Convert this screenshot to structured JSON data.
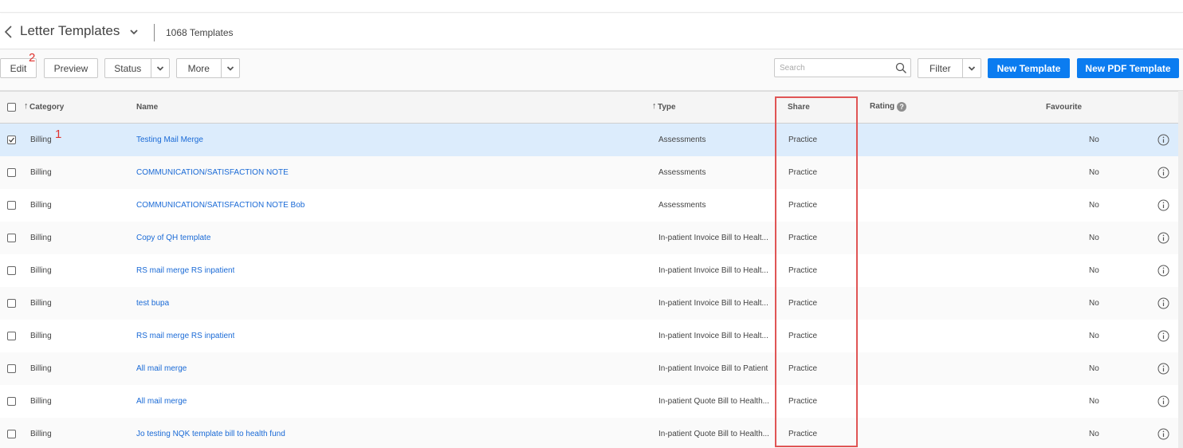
{
  "header": {
    "title": "Letter Templates",
    "count": "1068 Templates"
  },
  "toolbar": {
    "edit_label": "Edit",
    "preview_label": "Preview",
    "status_label": "Status",
    "more_label": "More",
    "search_placeholder": "Search",
    "filter_label": "Filter",
    "new_template_label": "New Template",
    "new_pdf_template_label": "New PDF Template"
  },
  "annotations": {
    "marker_1": "1",
    "marker_2": "2"
  },
  "columns": {
    "category": "Category",
    "name": "Name",
    "type": "Type",
    "share": "Share",
    "rating": "Rating",
    "rating_help": "?",
    "favourite": "Favourite"
  },
  "rows": [
    {
      "category": "Billing",
      "name": "Testing Mail Merge",
      "type": "Assessments",
      "share": "Practice",
      "favourite": "No",
      "checked": true
    },
    {
      "category": "Billing",
      "name": "COMMUNICATION/SATISFACTION NOTE",
      "type": "Assessments",
      "share": "Practice",
      "favourite": "No",
      "checked": false
    },
    {
      "category": "Billing",
      "name": "COMMUNICATION/SATISFACTION NOTE Bob",
      "type": "Assessments",
      "share": "Practice",
      "favourite": "No",
      "checked": false
    },
    {
      "category": "Billing",
      "name": "Copy of QH template",
      "type": "In-patient Invoice Bill to Healt...",
      "share": "Practice",
      "favourite": "No",
      "checked": false
    },
    {
      "category": "Billing",
      "name": "RS mail merge RS inpatient",
      "type": "In-patient Invoice Bill to Healt...",
      "share": "Practice",
      "favourite": "No",
      "checked": false
    },
    {
      "category": "Billing",
      "name": "test bupa",
      "type": "In-patient Invoice Bill to Healt...",
      "share": "Practice",
      "favourite": "No",
      "checked": false
    },
    {
      "category": "Billing",
      "name": "RS mail merge RS inpatient",
      "type": "In-patient Invoice Bill to Healt...",
      "share": "Practice",
      "favourite": "No",
      "checked": false
    },
    {
      "category": "Billing",
      "name": "All mail merge",
      "type": "In-patient Invoice Bill to Patient",
      "share": "Practice",
      "favourite": "No",
      "checked": false
    },
    {
      "category": "Billing",
      "name": "All mail merge",
      "type": "In-patient Quote Bill to Health...",
      "share": "Practice",
      "favourite": "No",
      "checked": false
    },
    {
      "category": "Billing",
      "name": "Jo testing NQK template bill to health fund",
      "type": "In-patient Quote Bill to Health...",
      "share": "Practice",
      "favourite": "No",
      "checked": false
    }
  ],
  "colors": {
    "primary": "#0b7cf0",
    "link": "#1a6ad6",
    "highlight": "#e05555",
    "selected_row": "#dcecfc"
  },
  "icons": [
    "chevron-left-icon",
    "chevron-down-icon",
    "search-icon",
    "sort-up-icon",
    "info-icon",
    "checkbox-icon"
  ]
}
